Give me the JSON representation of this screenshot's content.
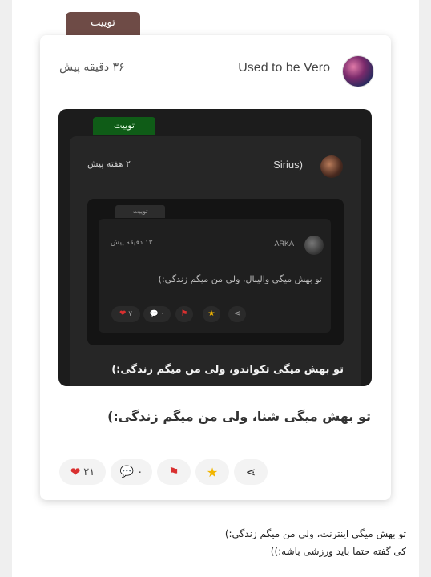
{
  "outer_tab_label": "توییت",
  "post": {
    "author": "Used to be Vero",
    "time": "۳۶ دقیقه پیش",
    "text": "تو بهش میگی شنا، ولی من میگم زندگی:)",
    "actions": {
      "likes": "۲۱",
      "comments": "۰"
    }
  },
  "embed": {
    "tab_label": "توییت",
    "author": "Sirius)",
    "time": "۲ هفته پیش",
    "text": "تو بهش میگی تکواندو، ولی من میگم زندگی:)",
    "inner": {
      "tab_label": "توییت",
      "author": "ARKA",
      "time": "۱۳ دقیقه پیش",
      "text": "تو بهش میگی والیبال، ولی من میگم زندگی:)",
      "likes": "۷",
      "comments": "۰"
    }
  },
  "footer": {
    "line1": "تو بهش میگی اینترنت، ولی من میگم زندگی:)",
    "line2": "کی گفته حتما باید ورزشی باشه:))"
  },
  "colors": {
    "tab_brown": "#6e4b46",
    "tab_green": "#0f5c17",
    "heart_red": "#d93030",
    "star_yellow": "#f2b600"
  }
}
